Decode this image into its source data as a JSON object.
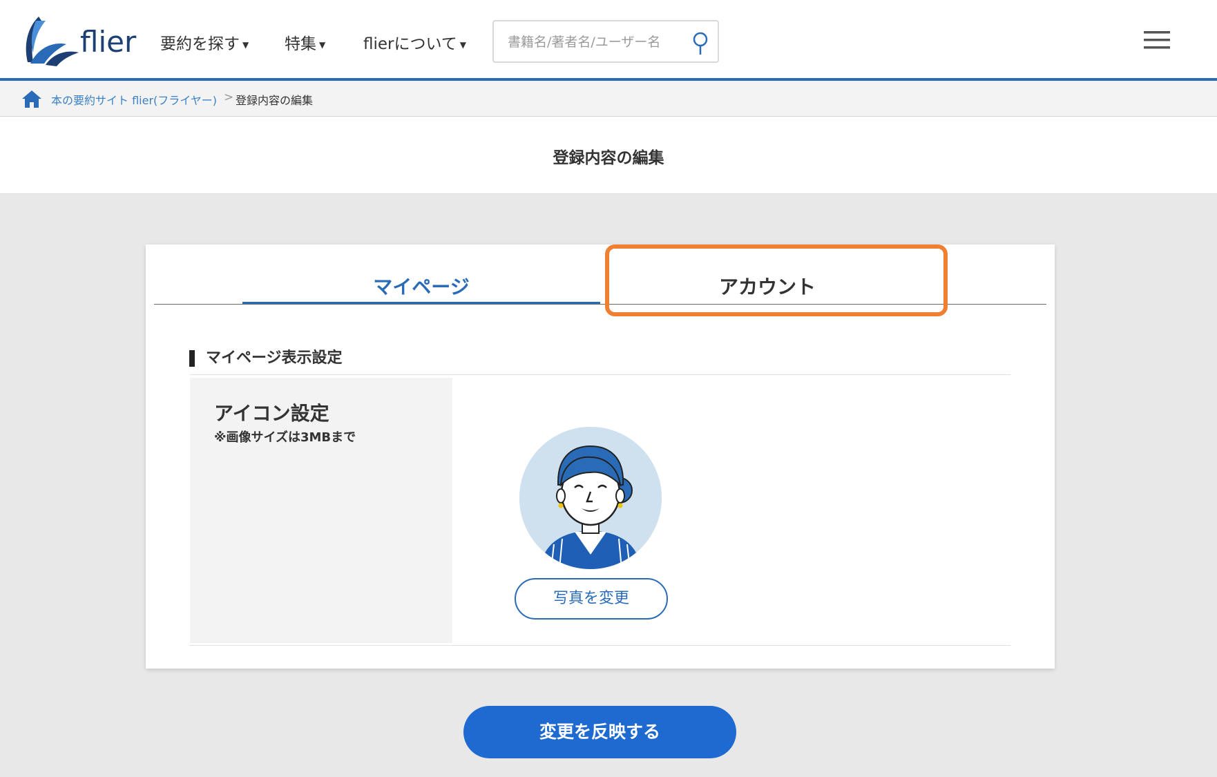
{
  "header": {
    "logo_text": "flier",
    "nav": [
      {
        "label": "要約を探す"
      },
      {
        "label": "特集"
      },
      {
        "label": "flierについて"
      }
    ],
    "search": {
      "placeholder": "書籍名/著者名/ユーザー名",
      "value": ""
    }
  },
  "breadcrumb": {
    "home_label": "本の要約サイト flier(フライヤー)",
    "separator": ">",
    "current": "登録内容の編集"
  },
  "page": {
    "title": "登録内容の編集"
  },
  "tabs": [
    {
      "label": "マイページ",
      "active": true
    },
    {
      "label": "アカウント",
      "active": false
    }
  ],
  "section": {
    "heading": "マイページ表示設定",
    "icon_label": "アイコン設定",
    "icon_note": "※画像サイズは3MBまで",
    "change_photo_label": "写真を変更"
  },
  "submit_label": "変更を反映する",
  "colors": {
    "primary": "#2a6bb7",
    "button": "#1f6ad0",
    "highlight": "#ef8033",
    "background": "#e8e8e8"
  }
}
